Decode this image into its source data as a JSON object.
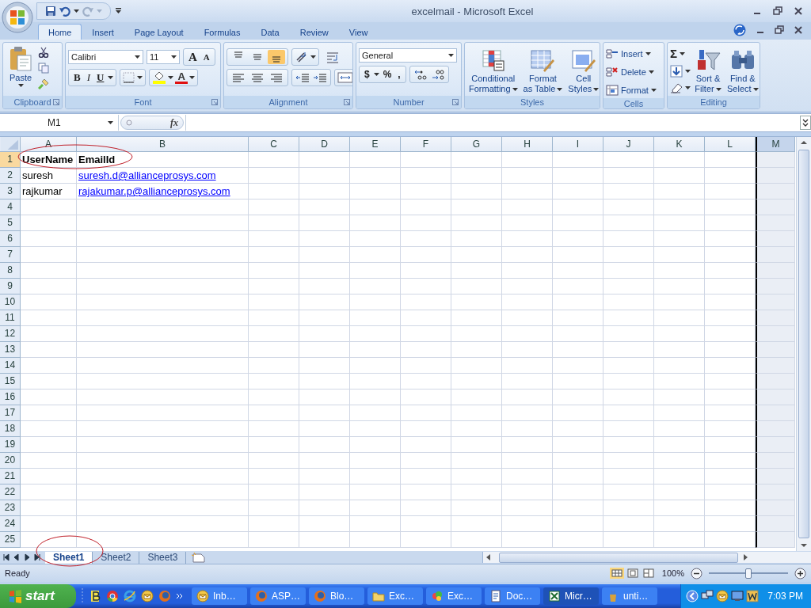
{
  "window": {
    "title": "excelmail - Microsoft Excel"
  },
  "ribbon": {
    "tabs": [
      {
        "label": "Home",
        "selected": true
      },
      {
        "label": "Insert",
        "selected": false
      },
      {
        "label": "Page Layout",
        "selected": false
      },
      {
        "label": "Formulas",
        "selected": false
      },
      {
        "label": "Data",
        "selected": false
      },
      {
        "label": "Review",
        "selected": false
      },
      {
        "label": "View",
        "selected": false
      }
    ],
    "clipboard": {
      "label": "Clipboard",
      "paste": "Paste"
    },
    "font": {
      "label": "Font",
      "font_name": "Calibri",
      "font_size": "11",
      "size_buttons": [
        "A",
        "A"
      ],
      "style_buttons": [
        "B",
        "I",
        "U"
      ],
      "color_button": "A"
    },
    "alignment": {
      "label": "Alignment",
      "vertical_align": [
        {
          "selected": false
        },
        {
          "selected": false
        },
        {
          "selected": true
        }
      ]
    },
    "number": {
      "label": "Number",
      "format": "General",
      "symbols": [
        "$",
        "%",
        ","
      ]
    },
    "styles": {
      "label": "Styles",
      "buttons": [
        {
          "kind": "conditional",
          "lines": [
            "Conditional",
            "Formatting"
          ]
        },
        {
          "kind": "table",
          "lines": [
            "Format",
            "as Table"
          ]
        },
        {
          "kind": "cellstyles",
          "lines": [
            "Cell",
            "Styles"
          ]
        }
      ]
    },
    "cells": {
      "label": "Cells",
      "buttons": [
        {
          "kind": "insert",
          "label": "Insert"
        },
        {
          "kind": "delete",
          "label": "Delete"
        },
        {
          "kind": "format",
          "label": "Format"
        }
      ]
    },
    "editing": {
      "label": "Editing",
      "sum": "Σ",
      "buttons": [
        {
          "kind": "sort",
          "lines": [
            "Sort &",
            "Filter"
          ]
        },
        {
          "kind": "find",
          "lines": [
            "Find &",
            "Select"
          ]
        }
      ]
    }
  },
  "formula_bar": {
    "name_box": "M1",
    "fx": "fx"
  },
  "sheet": {
    "header_circled": true,
    "columns": [
      {
        "label": "A",
        "selected": false
      },
      {
        "label": "B",
        "selected": false
      },
      {
        "label": "C",
        "selected": false
      },
      {
        "label": "D",
        "selected": false
      },
      {
        "label": "E",
        "selected": false
      },
      {
        "label": "F",
        "selected": false
      },
      {
        "label": "G",
        "selected": false
      },
      {
        "label": "H",
        "selected": false
      },
      {
        "label": "I",
        "selected": false
      },
      {
        "label": "J",
        "selected": false
      },
      {
        "label": "K",
        "selected": false
      },
      {
        "label": "L",
        "selected": false
      },
      {
        "label": "M",
        "selected": true
      }
    ],
    "rows": [
      {
        "number": "1",
        "selected": true,
        "cells": [
          {
            "text": "UserName",
            "kind": "bold"
          },
          {
            "text": "EmailId",
            "kind": "bold"
          }
        ]
      },
      {
        "number": "2",
        "selected": false,
        "cells": [
          {
            "text": "suresh",
            "kind": "plain"
          },
          {
            "text": "suresh.d@allianceprosys.com",
            "kind": "link"
          }
        ]
      },
      {
        "number": "3",
        "selected": false,
        "cells": [
          {
            "text": "rajkumar",
            "kind": "plain"
          },
          {
            "text": "rajakumar.p@allianceprosys.com",
            "kind": "link"
          }
        ]
      },
      {
        "number": "4",
        "selected": false
      },
      {
        "number": "5",
        "selected": false
      },
      {
        "number": "6",
        "selected": false
      },
      {
        "number": "7",
        "selected": false
      },
      {
        "number": "8",
        "selected": false
      },
      {
        "number": "9",
        "selected": false
      },
      {
        "number": "10",
        "selected": false
      },
      {
        "number": "11",
        "selected": false
      },
      {
        "number": "12",
        "selected": false
      },
      {
        "number": "13",
        "selected": false
      },
      {
        "number": "14",
        "selected": false
      },
      {
        "number": "15",
        "selected": false
      },
      {
        "number": "16",
        "selected": false
      },
      {
        "number": "17",
        "selected": false
      },
      {
        "number": "18",
        "selected": false
      },
      {
        "number": "19",
        "selected": false
      },
      {
        "number": "20",
        "selected": false
      },
      {
        "number": "21",
        "selected": false
      },
      {
        "number": "22",
        "selected": false
      },
      {
        "number": "23",
        "selected": false
      },
      {
        "number": "24",
        "selected": false
      },
      {
        "number": "25",
        "selected": false
      }
    ]
  },
  "sheet_tabs": [
    {
      "label": "Sheet1",
      "selected": true,
      "circled": true
    },
    {
      "label": "Sheet2",
      "selected": false,
      "circled": false
    },
    {
      "label": "Sheet3",
      "selected": false,
      "circled": false
    }
  ],
  "status_bar": {
    "status": "Ready",
    "zoom": "100%",
    "zoom_slider": {
      "level": 0.5
    }
  },
  "taskbar": {
    "start": "start",
    "buttons": [
      {
        "label": "Inb…",
        "kind": "mail",
        "selected": false
      },
      {
        "label": "ASP…",
        "kind": "browser",
        "selected": false
      },
      {
        "label": "Blo…",
        "kind": "browser",
        "selected": false
      },
      {
        "label": "Exc…",
        "kind": "folder",
        "selected": false
      },
      {
        "label": "Exc…",
        "kind": "paint",
        "selected": false
      },
      {
        "label": "Doc…",
        "kind": "document",
        "selected": false
      },
      {
        "label": "Micr…",
        "kind": "sheet",
        "selected": true
      },
      {
        "label": "unti…",
        "kind": "brush",
        "selected": false
      }
    ],
    "time": "7:03 PM"
  }
}
